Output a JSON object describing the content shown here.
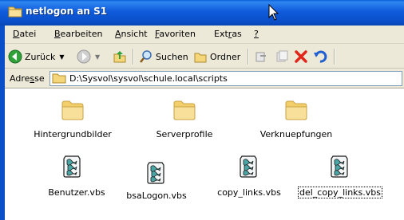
{
  "window": {
    "title": "netlogon an S1"
  },
  "menu": [
    {
      "label": "Datei",
      "mnemonic": "D"
    },
    {
      "label": "Bearbeiten",
      "mnemonic": "B"
    },
    {
      "label": "Ansicht",
      "mnemonic": "A"
    },
    {
      "label": "Favoriten",
      "mnemonic": "F"
    },
    {
      "label": "Extras",
      "mnemonic": "r"
    },
    {
      "label": "?",
      "mnemonic": ""
    }
  ],
  "toolbar": {
    "back_label": "Zurück",
    "search_label": "Suchen",
    "folders_label": "Ordner"
  },
  "address": {
    "label": "Adresse",
    "value": "D:\\Sysvol\\sysvol\\schule.local\\scripts"
  },
  "items": [
    {
      "name": "Hintergrundbilder",
      "type": "folder"
    },
    {
      "name": "Serverprofile",
      "type": "folder"
    },
    {
      "name": "Verknuepfungen",
      "type": "folder"
    },
    {
      "name": "Benutzer.vbs",
      "type": "vbs"
    },
    {
      "name": "bsaLogon.vbs",
      "type": "vbs"
    },
    {
      "name": "copy_links.vbs",
      "type": "vbs"
    },
    {
      "name": "del_copy_links.vbs",
      "type": "vbs",
      "selected": true
    }
  ],
  "colors": {
    "titlebar": "#0a4fc8",
    "chrome": "#ece9d8",
    "folder": "#f5d67a"
  }
}
